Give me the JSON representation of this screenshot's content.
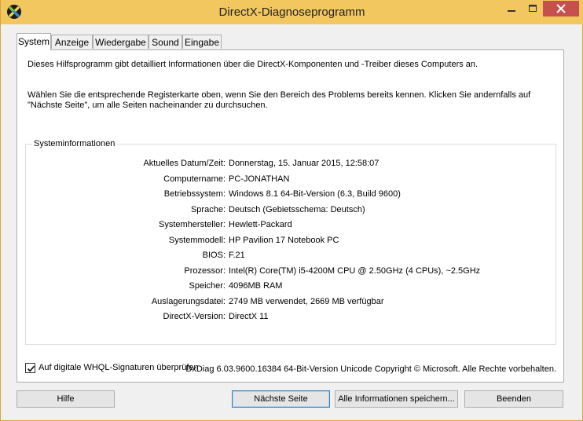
{
  "window": {
    "title": "DirectX-Diagnoseprogramm",
    "icon": "directx-icon"
  },
  "title_buttons": {
    "minimize_icon": "minimize-icon",
    "maximize_icon": "maximize-icon",
    "close_icon": "close-icon",
    "close_color": "#c7504f"
  },
  "tabs": [
    {
      "label": "System",
      "active": true
    },
    {
      "label": "Anzeige",
      "active": false
    },
    {
      "label": "Wiedergabe",
      "active": false
    },
    {
      "label": "Sound",
      "active": false
    },
    {
      "label": "Eingabe",
      "active": false
    }
  ],
  "intro": {
    "line1": "Dieses Hilfsprogramm gibt detailliert Informationen über die DirectX-Komponenten und -Treiber dieses Computers an.",
    "line2": "Wählen Sie die entsprechende Registerkarte oben, wenn Sie den Bereich des Problems bereits kennen. Klicken Sie andernfalls auf \"Nächste Seite\", um alle Seiten nacheinander zu durchsuchen."
  },
  "sysinfo": {
    "legend": "Systeminformationen",
    "rows": [
      {
        "label": "Aktuelles Datum/Zeit:",
        "value": "Donnerstag, 15. Januar 2015, 12:58:07"
      },
      {
        "label": "Computername:",
        "value": "PC-JONATHAN"
      },
      {
        "label": "Betriebssystem:",
        "value": "Windows 8.1 64-Bit-Version (6.3, Build 9600)"
      },
      {
        "label": "Sprache:",
        "value": "Deutsch (Gebietsschema: Deutsch)"
      },
      {
        "label": "Systemhersteller:",
        "value": "Hewlett-Packard"
      },
      {
        "label": "Systemmodell:",
        "value": "HP Pavilion 17 Notebook PC"
      },
      {
        "label": "BIOS:",
        "value": "F.21"
      },
      {
        "label": "Prozessor:",
        "value": "Intel(R) Core(TM) i5-4200M CPU @ 2.50GHz (4 CPUs), ~2.5GHz"
      },
      {
        "label": "Speicher:",
        "value": "4096MB RAM"
      },
      {
        "label": "Auslagerungsdatei:",
        "value": "2749 MB verwendet, 2669 MB verfügbar"
      },
      {
        "label": "DirectX-Version:",
        "value": "DirectX 11"
      }
    ]
  },
  "whql": {
    "label": "Auf digitale WHQL-Signaturen überprüfen",
    "checked": true
  },
  "footer": {
    "copyright": "DxDiag 6.03.9600.16384 64-Bit-Version Unicode Copyright © Microsoft. Alle Rechte vorbehalten."
  },
  "buttons": {
    "help": "Hilfe",
    "next": "Nächste Seite",
    "save_all": "Alle Informationen speichern...",
    "exit": "Beenden"
  },
  "colors": {
    "titlebar": "#f2c75f",
    "close": "#c7504f",
    "dialog_bg": "#f0f0f0"
  }
}
